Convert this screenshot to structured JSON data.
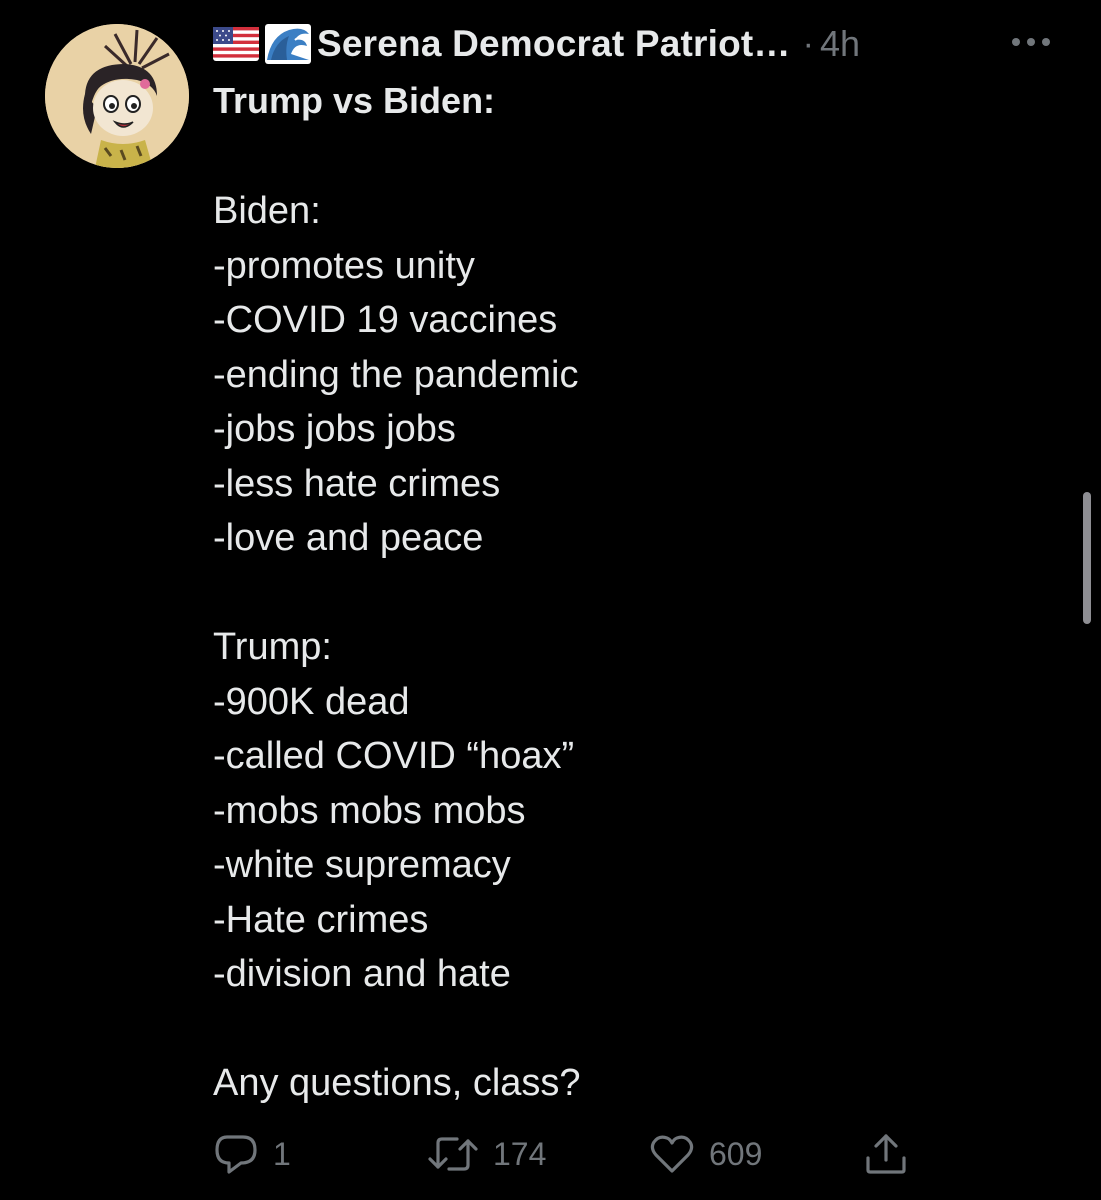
{
  "tweet": {
    "author": {
      "display_name": "Serena Democrat Patriot…",
      "emoji_prefix": [
        "us-flag-icon",
        "water-wave-icon"
      ]
    },
    "separator": "·",
    "timestamp": "4h",
    "title": "Trump vs Biden:",
    "body_lines": [
      "Biden:",
      "-promotes unity",
      "-COVID 19 vaccines",
      "-ending the pandemic",
      "-jobs jobs jobs",
      "-less hate crimes",
      "-love and peace",
      "",
      "Trump:",
      "-900K dead",
      "-called COVID “hoax”",
      "-mobs mobs mobs",
      "-white supremacy",
      "-Hate crimes",
      "-division and hate",
      "",
      "Any questions, class?"
    ],
    "actions": {
      "reply": {
        "icon": "reply-icon",
        "count": "1"
      },
      "retweet": {
        "icon": "retweet-icon",
        "count": "174"
      },
      "like": {
        "icon": "heart-icon",
        "count": "609"
      },
      "share": {
        "icon": "share-icon"
      }
    }
  },
  "colors": {
    "background": "#000000",
    "primary_text": "#e7e9ea",
    "secondary_text": "#71767b"
  }
}
